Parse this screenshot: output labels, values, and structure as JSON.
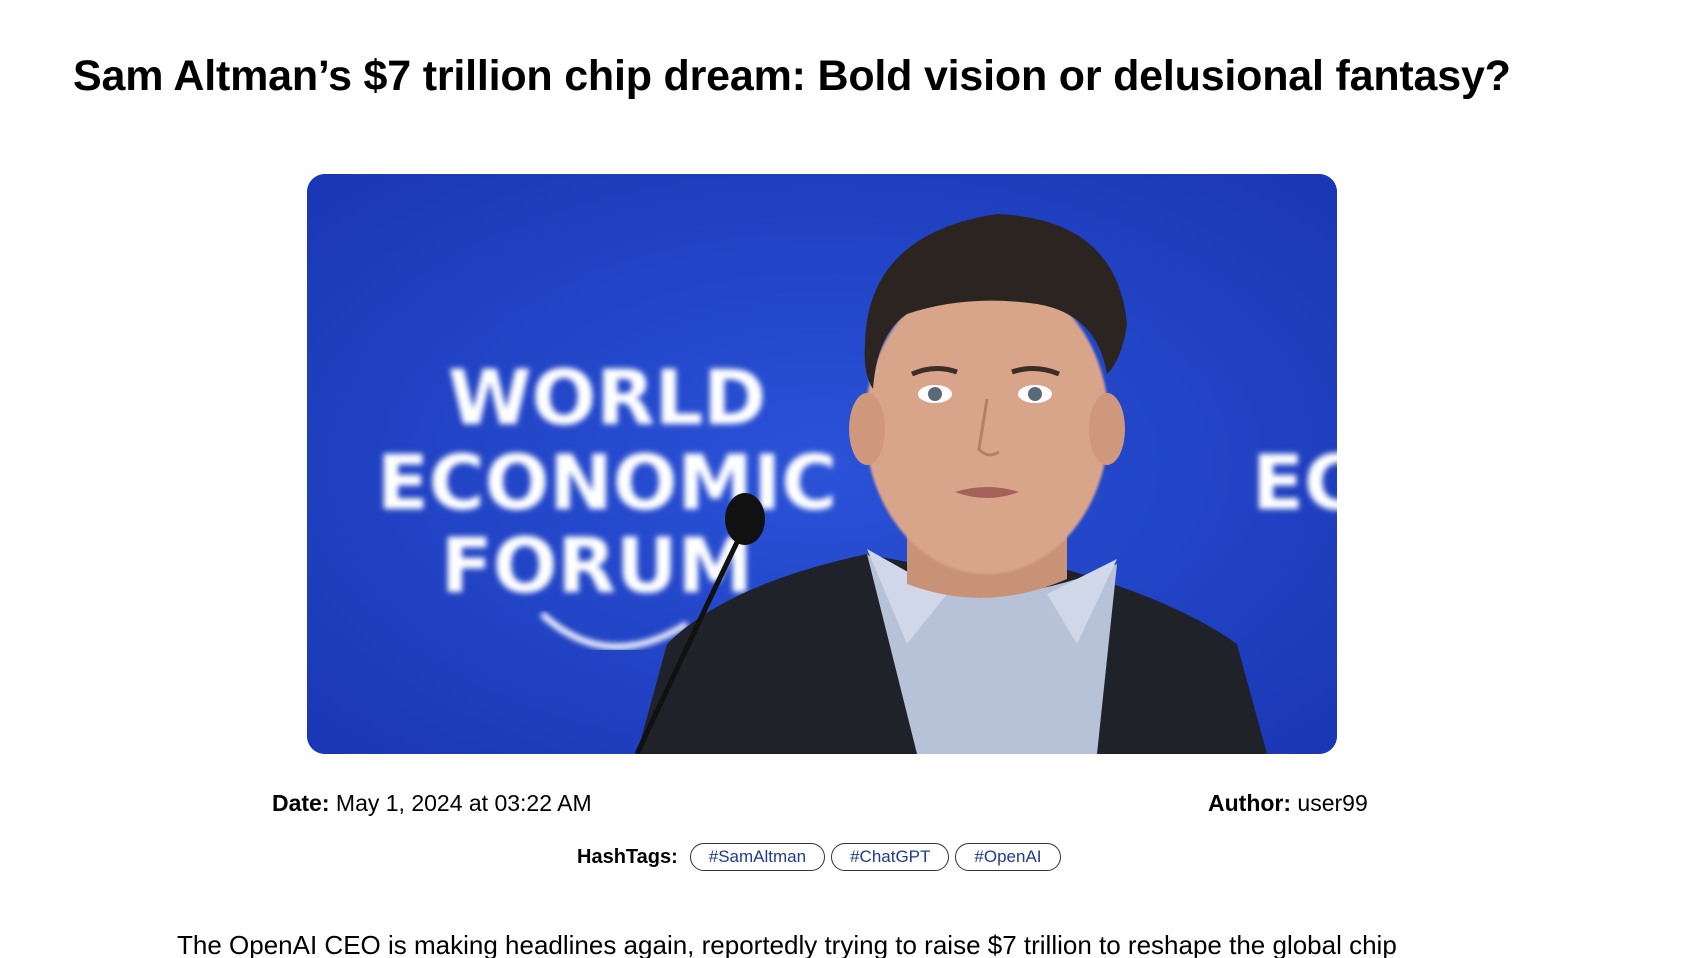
{
  "article": {
    "title": "Sam Altman’s $7 trillion chip dream: Bold vision or delusional fantasy?",
    "date_label": "Date:",
    "date_value": "May 1, 2024 at 03:22 AM",
    "author_label": "Author:",
    "author_value": "user99",
    "hashtags_label": "HashTags:",
    "hashtags": [
      "#SamAltman",
      "#ChatGPT",
      "#OpenAI"
    ],
    "body_first_line": "The OpenAI CEO is making headlines again, reportedly trying to raise $7 trillion to reshape the global chip"
  },
  "hero_image": {
    "backdrop_text_lines": [
      "WORLD",
      "ECONOMIC",
      "FORUM"
    ],
    "backdrop_text_right": "EC",
    "colors": {
      "backdrop": "#1e3fc4",
      "jacket": "#1f2329",
      "shirt": "#b7c2d8",
      "skin": "#d9a58a",
      "hair": "#2b2420"
    }
  },
  "colors": {
    "tag_text": "#1f3a93",
    "tag_border": "#333333"
  }
}
